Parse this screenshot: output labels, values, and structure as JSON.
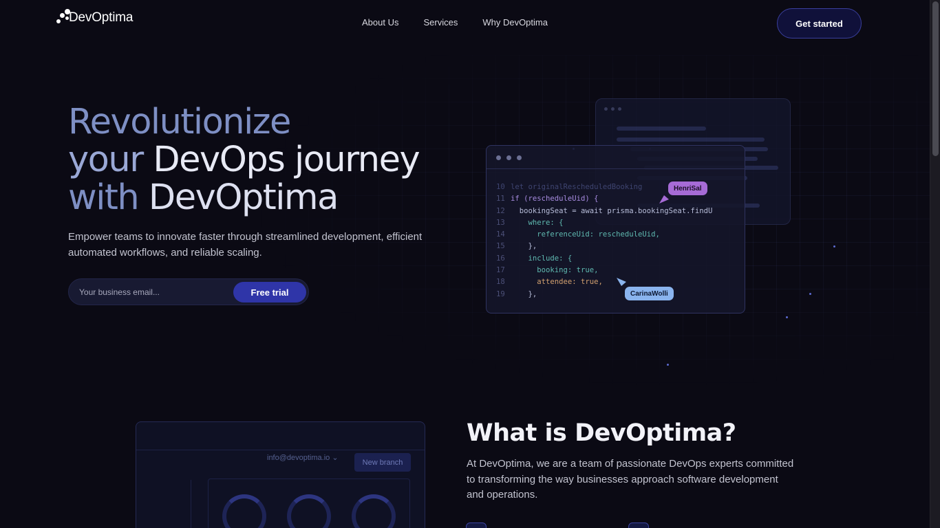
{
  "brand": {
    "name": "DevOptima"
  },
  "nav": {
    "items": [
      "About Us",
      "Services",
      "Why DevOptima"
    ]
  },
  "header": {
    "cta_label": "Get started"
  },
  "hero": {
    "title_line1": "Revolutionize",
    "title_line2a": "your ",
    "title_line2b": "DevOps journey",
    "title_line3a": "with ",
    "title_line3b": "DevOptima",
    "subtitle": "Empower teams to innovate faster through streamlined development, efficient automated workflows, and reliable scaling.",
    "email_placeholder": "Your business email...",
    "trial_label": "Free trial"
  },
  "code_window": {
    "lines": [
      {
        "n": "10",
        "text": "let originalRescheduledBooking"
      },
      {
        "n": "11",
        "text": "if (rescheduleUid) {"
      },
      {
        "n": "12",
        "text": "  bookingSeat = await prisma.bookingSeat.findU"
      },
      {
        "n": "13",
        "text": "    where: {"
      },
      {
        "n": "14",
        "text": "      referenceUid: rescheduleUid,"
      },
      {
        "n": "15",
        "text": "    },"
      },
      {
        "n": "16",
        "text": "    include: {"
      },
      {
        "n": "17",
        "text": "      booking: true,"
      },
      {
        "n": "18",
        "text": "      attendee: true,"
      },
      {
        "n": "19",
        "text": "    },"
      }
    ],
    "collaborators": [
      "HenriSal",
      "CarinaWolli"
    ]
  },
  "about": {
    "title": "What is DevOptima?",
    "text": "At DevOptima, we are a team of passionate DevOps experts committed to transforming the way businesses approach software development and operations.",
    "dashboard_email": "info@devoptima.io",
    "dashboard_button": "New branch"
  },
  "colors": {
    "accent": "#2f35a8",
    "background": "#0b0a14",
    "tag_purple": "#a66bd6",
    "tag_blue": "#8ab4ee"
  }
}
